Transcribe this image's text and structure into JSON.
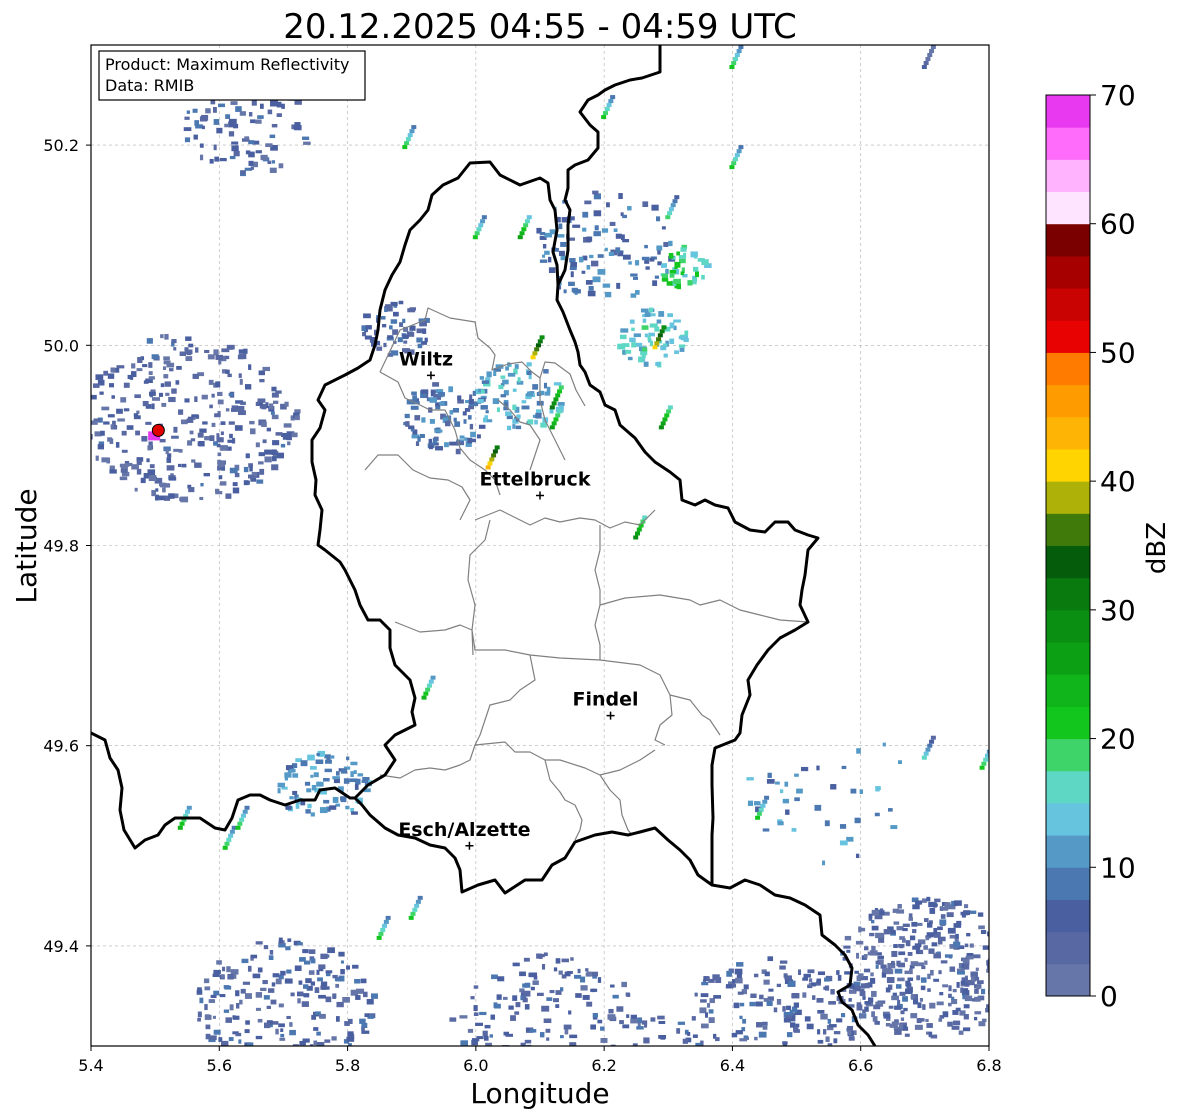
{
  "title": "20.12.2025 04:55 - 04:59 UTC",
  "info_box": {
    "product": "Product: Maximum Reflectivity",
    "data": "Data: RMIB"
  },
  "x_axis": {
    "label": "Longitude",
    "range": [
      5.4,
      6.8
    ],
    "ticks": [
      "5.4",
      "5.6",
      "5.8",
      "6.0",
      "6.2",
      "6.4",
      "6.6",
      "6.8"
    ]
  },
  "y_axis": {
    "label": "Latitude",
    "range": [
      49.3,
      50.3
    ],
    "ticks": [
      "49.4",
      "49.6",
      "49.8",
      "50.0",
      "50.2"
    ]
  },
  "grid": true,
  "colorbar": {
    "label": "dBZ",
    "range": [
      0,
      70
    ],
    "ticks": [
      "0",
      "10",
      "20",
      "30",
      "40",
      "50",
      "60",
      "70"
    ],
    "colors": [
      "#6676a8",
      "#5868a2",
      "#4a5fa0",
      "#4c78b1",
      "#559ac7",
      "#67c4df",
      "#5ed7c4",
      "#3fd46a",
      "#12c61e",
      "#0fb51a",
      "#0ca115",
      "#0b8f12",
      "#087a0e",
      "#055c0a",
      "#3f7a0a",
      "#aeb108",
      "#ffd400",
      "#fdb404",
      "#fe9b00",
      "#ff7b00",
      "#e80202",
      "#c90202",
      "#a60000",
      "#7a0000",
      "#ffe4ff",
      "#ffb3ff",
      "#ff6cfc",
      "#e838f0"
    ]
  },
  "places": [
    {
      "name": "Wiltz",
      "lon": 5.93,
      "lat": 49.97
    },
    {
      "name": "Ettelbruck",
      "lon": 6.1,
      "lat": 49.85
    },
    {
      "name": "Findel",
      "lon": 6.21,
      "lat": 49.63
    },
    {
      "name": "Esch/Alzette",
      "lon": 5.99,
      "lat": 49.5
    }
  ],
  "radar_site": {
    "lon": 5.505,
    "lat": 49.915
  },
  "echo_clusters": [
    {
      "lon": 5.55,
      "lat": 49.93,
      "size": 0.12,
      "n": 320,
      "dbz": 4
    },
    {
      "lon": 5.64,
      "lat": 50.22,
      "size": 0.07,
      "n": 90,
      "dbz": 5
    },
    {
      "lon": 5.87,
      "lat": 50.02,
      "size": 0.04,
      "n": 60,
      "dbz": 6
    },
    {
      "lon": 5.95,
      "lat": 49.93,
      "size": 0.05,
      "n": 90,
      "dbz": 8
    },
    {
      "lon": 6.06,
      "lat": 49.95,
      "size": 0.05,
      "n": 80,
      "dbz": 12
    },
    {
      "lon": 6.2,
      "lat": 50.1,
      "size": 0.08,
      "n": 110,
      "dbz": 8
    },
    {
      "lon": 6.27,
      "lat": 50.01,
      "size": 0.04,
      "n": 60,
      "dbz": 14
    },
    {
      "lon": 6.32,
      "lat": 50.08,
      "size": 0.03,
      "n": 40,
      "dbz": 18
    },
    {
      "lon": 5.76,
      "lat": 49.56,
      "size": 0.05,
      "n": 80,
      "dbz": 10
    },
    {
      "lon": 5.7,
      "lat": 49.34,
      "size": 0.1,
      "n": 220,
      "dbz": 5
    },
    {
      "lon": 6.12,
      "lat": 49.31,
      "size": 0.12,
      "n": 260,
      "dbz": 5
    },
    {
      "lon": 6.45,
      "lat": 49.32,
      "size": 0.1,
      "n": 220,
      "dbz": 5
    },
    {
      "lon": 6.7,
      "lat": 49.38,
      "size": 0.1,
      "n": 360,
      "dbz": 4
    },
    {
      "lon": 6.55,
      "lat": 49.55,
      "size": 0.1,
      "n": 40,
      "dbz": 10
    }
  ],
  "echo_streaks": [
    {
      "lon": 6.4,
      "lat": 50.18,
      "dbz": 22
    },
    {
      "lon": 6.4,
      "lat": 50.28,
      "dbz": 20
    },
    {
      "lon": 6.3,
      "lat": 50.13,
      "dbz": 18
    },
    {
      "lon": 6.28,
      "lat": 50.0,
      "dbz": 42
    },
    {
      "lon": 6.29,
      "lat": 49.92,
      "dbz": 28
    },
    {
      "lon": 6.2,
      "lat": 50.23,
      "dbz": 20
    },
    {
      "lon": 6.09,
      "lat": 49.99,
      "dbz": 40
    },
    {
      "lon": 6.12,
      "lat": 49.94,
      "dbz": 30
    },
    {
      "lon": 6.02,
      "lat": 49.88,
      "dbz": 44
    },
    {
      "lon": 6.0,
      "lat": 50.11,
      "dbz": 22
    },
    {
      "lon": 6.07,
      "lat": 50.11,
      "dbz": 26
    },
    {
      "lon": 6.12,
      "lat": 49.92,
      "dbz": 26
    },
    {
      "lon": 6.25,
      "lat": 49.81,
      "dbz": 28
    },
    {
      "lon": 5.61,
      "lat": 49.5,
      "dbz": 20
    },
    {
      "lon": 5.54,
      "lat": 49.52,
      "dbz": 24
    },
    {
      "lon": 5.63,
      "lat": 49.52,
      "dbz": 22
    },
    {
      "lon": 5.92,
      "lat": 49.65,
      "dbz": 24
    },
    {
      "lon": 5.85,
      "lat": 49.41,
      "dbz": 22
    },
    {
      "lon": 5.9,
      "lat": 49.43,
      "dbz": 20
    },
    {
      "lon": 6.44,
      "lat": 49.53,
      "dbz": 20
    },
    {
      "lon": 6.7,
      "lat": 49.59,
      "dbz": 16
    },
    {
      "lon": 6.79,
      "lat": 49.58,
      "dbz": 22
    },
    {
      "lon": 6.7,
      "lat": 50.28,
      "dbz": 6
    },
    {
      "lon": 5.89,
      "lat": 50.2,
      "dbz": 22
    }
  ],
  "site_echo": {
    "lon": 5.5,
    "lat": 49.91,
    "dbz": 68
  }
}
